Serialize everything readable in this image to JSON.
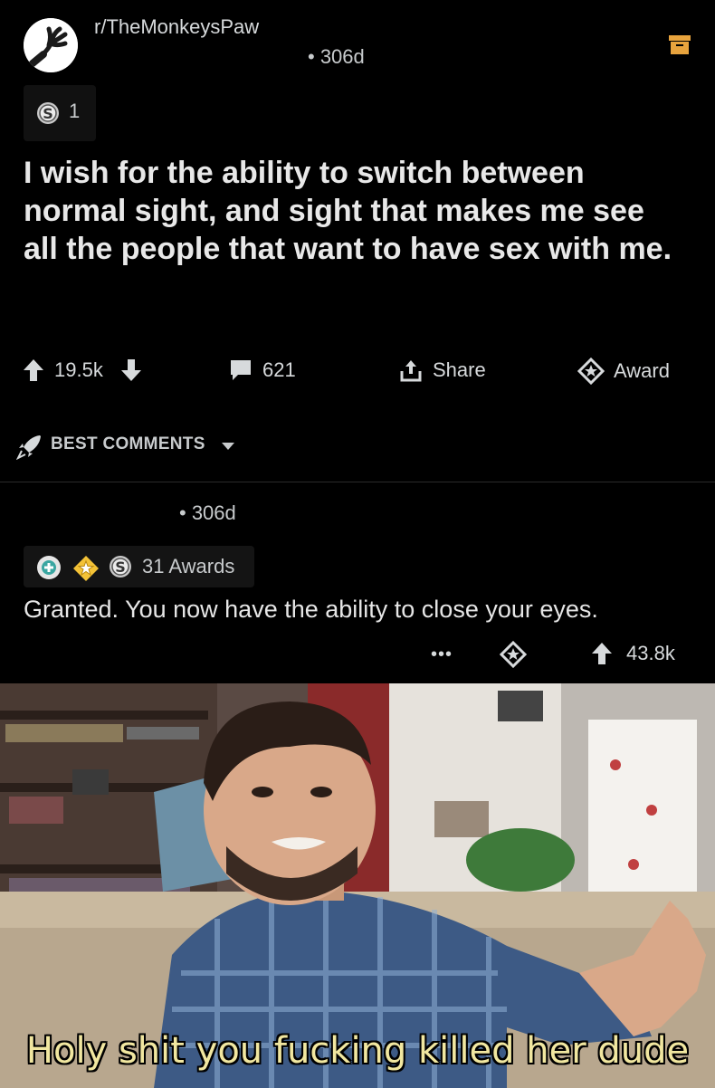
{
  "post": {
    "subreddit": "r/TheMonkeysPaw",
    "age": "• 306d",
    "award_count": "1",
    "title": "I wish for the ability to switch between normal sight, and sight that makes me see all the people that want to have sex with me."
  },
  "actions": {
    "upvotes": "19.5k",
    "comments": "621",
    "share_label": "Share",
    "award_label": "Award"
  },
  "sort": {
    "label": "BEST COMMENTS"
  },
  "comment": {
    "age": "• 306d",
    "awards_label": "31 Awards",
    "body": "Granted. You now have the ability to close your eyes.",
    "score": "43.8k",
    "more_label": "•••"
  },
  "meme": {
    "caption": "Holy shit you fucking killed her dude"
  },
  "colors": {
    "background": "#000000",
    "text": "#d7dadc",
    "save_icon": "#e8a33d",
    "caption": "#f1e7a0"
  }
}
